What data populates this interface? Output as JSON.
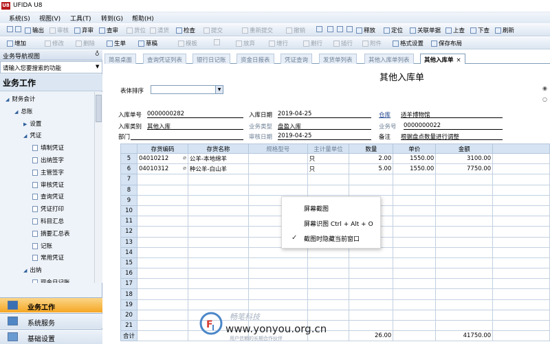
{
  "app": {
    "title": "UFIDA U8",
    "logo": "U8"
  },
  "menu": [
    "系统(S)",
    "视图(V)",
    "工具(T)",
    "转到(G)",
    "帮助(H)"
  ],
  "toolbar1": [
    {
      "label": "",
      "icon": "print-icon",
      "disabled": false
    },
    {
      "label": "",
      "icon": "preview-icon",
      "disabled": false
    },
    {
      "label": "输出",
      "icon": "export-icon",
      "disabled": false
    },
    {
      "label": "审核",
      "icon": "audit-icon",
      "disabled": true
    },
    {
      "label": "弃审",
      "icon": "unaudit-icon",
      "disabled": false
    },
    {
      "label": "查审",
      "icon": "check-audit-icon",
      "disabled": false
    },
    {
      "label": "货位",
      "icon": "location-icon",
      "disabled": true
    },
    {
      "label": "清货",
      "icon": "clear-icon",
      "disabled": true
    },
    {
      "label": "检查",
      "icon": "inspect-icon",
      "disabled": false
    },
    {
      "label": "提交",
      "icon": "submit-icon",
      "disabled": true
    },
    {
      "label": "重新提交",
      "icon": "resubmit-icon",
      "disabled": true
    },
    {
      "label": "撤销",
      "icon": "revoke-icon",
      "disabled": true
    },
    {
      "label": "",
      "icon": "first-icon",
      "disabled": false
    },
    {
      "label": "",
      "icon": "prev-icon",
      "disabled": false
    },
    {
      "label": "",
      "icon": "next-icon",
      "disabled": false
    },
    {
      "label": "",
      "icon": "last-icon",
      "disabled": false
    },
    {
      "label": "释放",
      "icon": "release-icon",
      "disabled": false
    },
    {
      "label": "定位",
      "icon": "locate-icon",
      "disabled": false
    },
    {
      "label": "关联单据",
      "icon": "related-doc-icon",
      "disabled": false
    },
    {
      "label": "上查",
      "icon": "trace-up-icon",
      "disabled": false
    },
    {
      "label": "下查",
      "icon": "trace-down-icon",
      "disabled": false
    },
    {
      "label": "刷新",
      "icon": "refresh-icon",
      "disabled": false
    }
  ],
  "toolbar2": [
    {
      "label": "增加",
      "icon": "add-icon",
      "disabled": false
    },
    {
      "label": "修改",
      "icon": "edit-icon",
      "disabled": true
    },
    {
      "label": "删除",
      "icon": "delete-icon",
      "disabled": true
    },
    {
      "label": "生单",
      "icon": "generate-icon",
      "disabled": false
    },
    {
      "label": "草稿",
      "icon": "draft-icon",
      "disabled": false
    },
    {
      "label": "模板",
      "icon": "template-icon",
      "disabled": true
    },
    {
      "label": "",
      "icon": "save-icon",
      "disabled": true
    },
    {
      "label": "放弃",
      "icon": "discard-icon",
      "disabled": true
    },
    {
      "label": "增行",
      "icon": "add-row-icon",
      "disabled": true
    },
    {
      "label": "删行",
      "icon": "delete-row-icon",
      "disabled": true
    },
    {
      "label": "插行",
      "icon": "insert-row-icon",
      "disabled": true
    },
    {
      "label": "附件",
      "icon": "attachment-icon",
      "disabled": true
    },
    {
      "label": "格式设置",
      "icon": "format-icon",
      "disabled": false
    },
    {
      "label": "保存布局",
      "icon": "save-layout-icon",
      "disabled": false
    }
  ],
  "nav": {
    "header": "业务导航视图",
    "search_placeholder": "请输入您要搜索的功能",
    "section": "业务工作",
    "tree": [
      {
        "label": "财务会计",
        "level": 0,
        "type": "folder"
      },
      {
        "label": "总账",
        "level": 1,
        "type": "folder"
      },
      {
        "label": "设置",
        "level": 2,
        "type": "folder-closed"
      },
      {
        "label": "凭证",
        "level": 2,
        "type": "folder"
      },
      {
        "label": "填制凭证",
        "level": 3,
        "type": "doc"
      },
      {
        "label": "出纳签字",
        "level": 3,
        "type": "doc"
      },
      {
        "label": "主管签字",
        "level": 3,
        "type": "doc"
      },
      {
        "label": "审核凭证",
        "level": 3,
        "type": "doc"
      },
      {
        "label": "查询凭证",
        "level": 3,
        "type": "doc"
      },
      {
        "label": "凭证打印",
        "level": 3,
        "type": "doc"
      },
      {
        "label": "科目汇总",
        "level": 3,
        "type": "doc"
      },
      {
        "label": "摘要汇总表",
        "level": 3,
        "type": "doc"
      },
      {
        "label": "记账",
        "level": 3,
        "type": "doc"
      },
      {
        "label": "常用凭证",
        "level": 3,
        "type": "doc"
      },
      {
        "label": "出纳",
        "level": 2,
        "type": "folder"
      },
      {
        "label": "现金日记账",
        "level": 3,
        "type": "doc"
      }
    ],
    "buttons": [
      "业务工作",
      "系统服务",
      "基础设置"
    ]
  },
  "tabs": [
    "简易桌面",
    "查询凭证列表",
    "银行日记账",
    "资金日报表",
    "凭证查询",
    "发货单列表",
    "其他入库单列表",
    "其他入库单"
  ],
  "form": {
    "title": "其他入库单",
    "sort_label": "表体排序",
    "fields": {
      "in_no_label": "入库单号",
      "in_no": "0000000282",
      "in_date_label": "入库日期",
      "in_date": "2019-04-25",
      "warehouse_label": "仓库",
      "warehouse": "适羊博物馆",
      "in_type_label": "入库类别",
      "in_type": "其他入库",
      "biz_type_label": "业务类型",
      "biz_type": "盘盈入库",
      "biz_no_label": "业务号",
      "biz_no": "0000000022",
      "dept_label": "部门",
      "dept": "",
      "audit_date_label": "审核日期",
      "audit_date": "2019-04-25",
      "remark_label": "备注",
      "remark": "根据盘点数量进行调整"
    }
  },
  "table": {
    "columns": [
      "存货编码",
      "存货名称",
      "规格型号",
      "主计量单位",
      "数量",
      "单价",
      "金额"
    ],
    "rows": [
      {
        "n": "5",
        "code": "04010212",
        "name": "公羊-本地绵羊",
        "spec": "",
        "unit": "只",
        "qty": "2.00",
        "price": "1550.00",
        "amount": "3100.00"
      },
      {
        "n": "6",
        "code": "04010312",
        "name": "种公羊-白山羊",
        "spec": "",
        "unit": "只",
        "qty": "5.00",
        "price": "1550.00",
        "amount": "7750.00"
      },
      {
        "n": "7"
      },
      {
        "n": "8"
      },
      {
        "n": "9"
      },
      {
        "n": "10"
      },
      {
        "n": "11"
      },
      {
        "n": "12"
      },
      {
        "n": "13"
      },
      {
        "n": "14"
      },
      {
        "n": "15"
      },
      {
        "n": "16"
      },
      {
        "n": "17"
      },
      {
        "n": "18"
      },
      {
        "n": "19"
      },
      {
        "n": "20"
      },
      {
        "n": "21"
      }
    ],
    "total_label": "合计",
    "total_qty": "26.00",
    "total_amount": "41750.00"
  },
  "context_menu": {
    "items": [
      "屏幕截图",
      "屏幕识图 Ctrl + Alt + O",
      "截图时隐藏当前窗口"
    ],
    "checked_index": 2
  },
  "watermark": {
    "cn": "畅笔科技",
    "url": "www.yonyou.org.cn",
    "sub": "用户信赖的长期合作伙伴"
  }
}
